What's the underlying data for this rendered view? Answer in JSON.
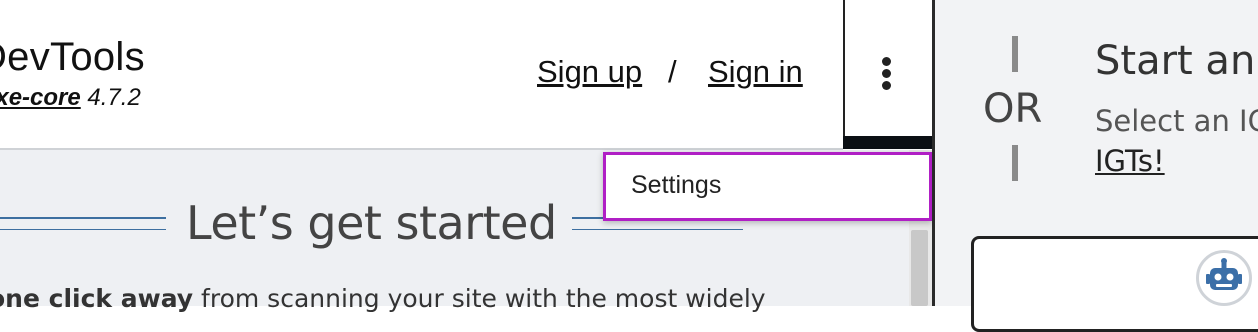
{
  "header": {
    "app_title": "DevTools",
    "library_name": "axe-core",
    "library_version": "4.7.2",
    "sign_up_label": "Sign up",
    "auth_separator": "/",
    "sign_in_label": "Sign in"
  },
  "menu": {
    "icon": "kebab-menu-icon",
    "items": [
      {
        "label": "Settings"
      }
    ]
  },
  "main": {
    "heading": "Let’s get started",
    "intro_bold": "one click away",
    "intro_rest": " from scanning your site with the most widely"
  },
  "right_panel": {
    "or_label": "OR",
    "title": "Start an",
    "subtitle": "Select an IG",
    "link_label": "IGTs!",
    "bot_icon": "robot-icon"
  },
  "colors": {
    "accent_rule": "#3d6fa0",
    "dropdown_focus": "#b01fc5",
    "content_bg": "#eef0f3",
    "right_bg": "#f2f3f5"
  }
}
